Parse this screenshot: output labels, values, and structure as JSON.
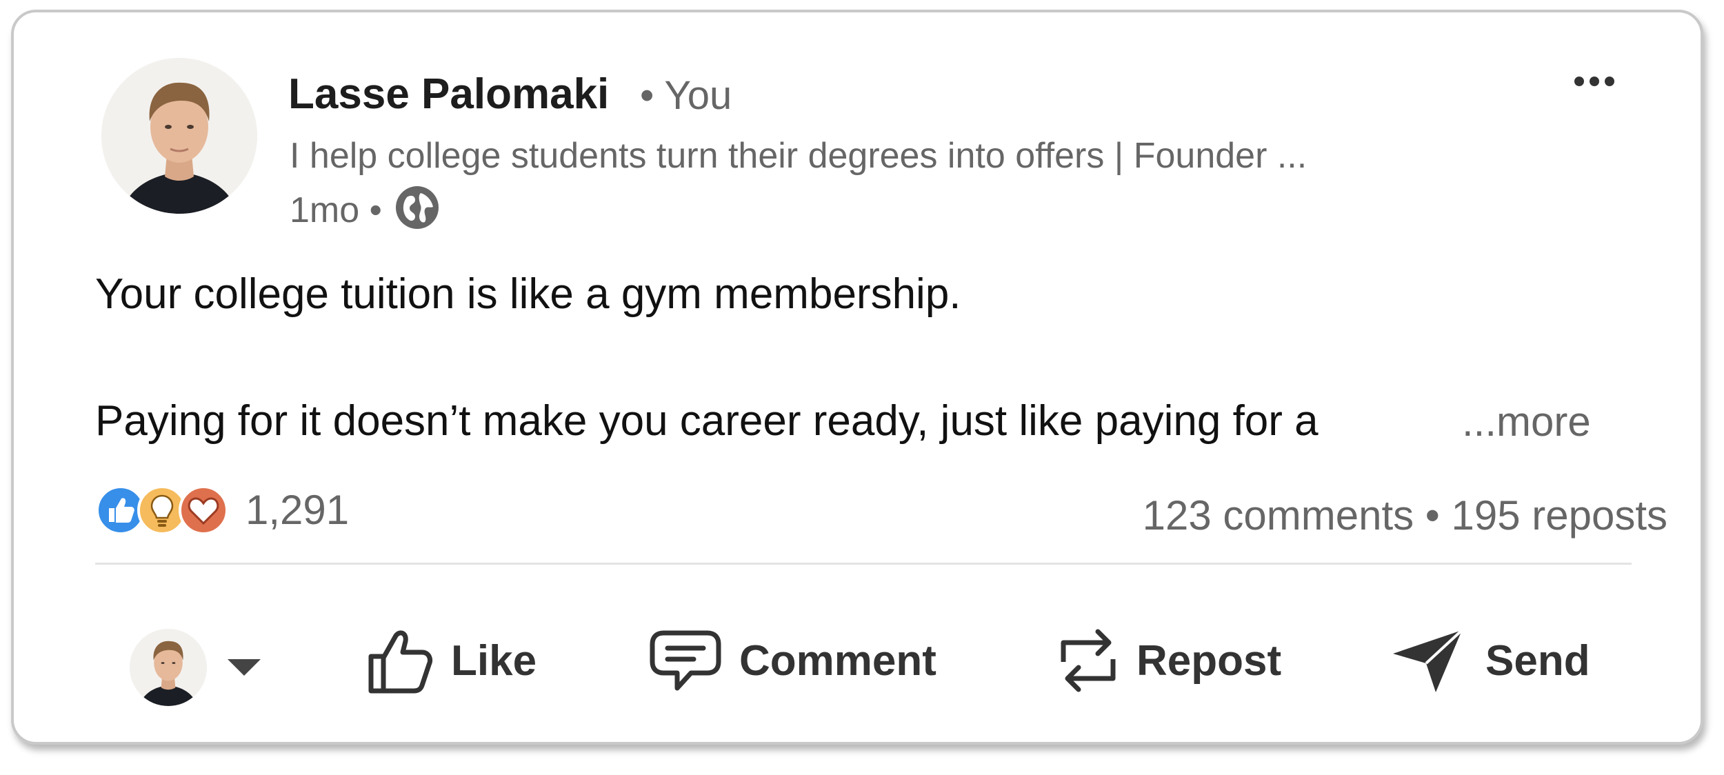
{
  "author": {
    "name": "Lasse Palomaki",
    "relation": "• You",
    "headline": "I help college students turn their degrees into offers | Founder ...",
    "timestamp": "1mo •",
    "visibility_icon": "globe-icon"
  },
  "post": {
    "line1": "Your college tuition is like a gym membership.",
    "line2": "Paying for it doesn’t make you career ready, just like paying for a",
    "see_more": "...more"
  },
  "social": {
    "reaction_icons": [
      "like-icon",
      "insightful-icon",
      "love-icon"
    ],
    "reactions_count": "1,291",
    "comments_reposts": "123 comments • 195 reposts"
  },
  "actions": {
    "like": "Like",
    "comment": "Comment",
    "repost": "Repost",
    "send": "Send"
  },
  "colors": {
    "like_blue": "#378fe9",
    "insightful_yellow": "#f5bb5c",
    "love_red": "#df704d",
    "text_secondary": "#666666",
    "text_primary": "#1d1d1d"
  }
}
